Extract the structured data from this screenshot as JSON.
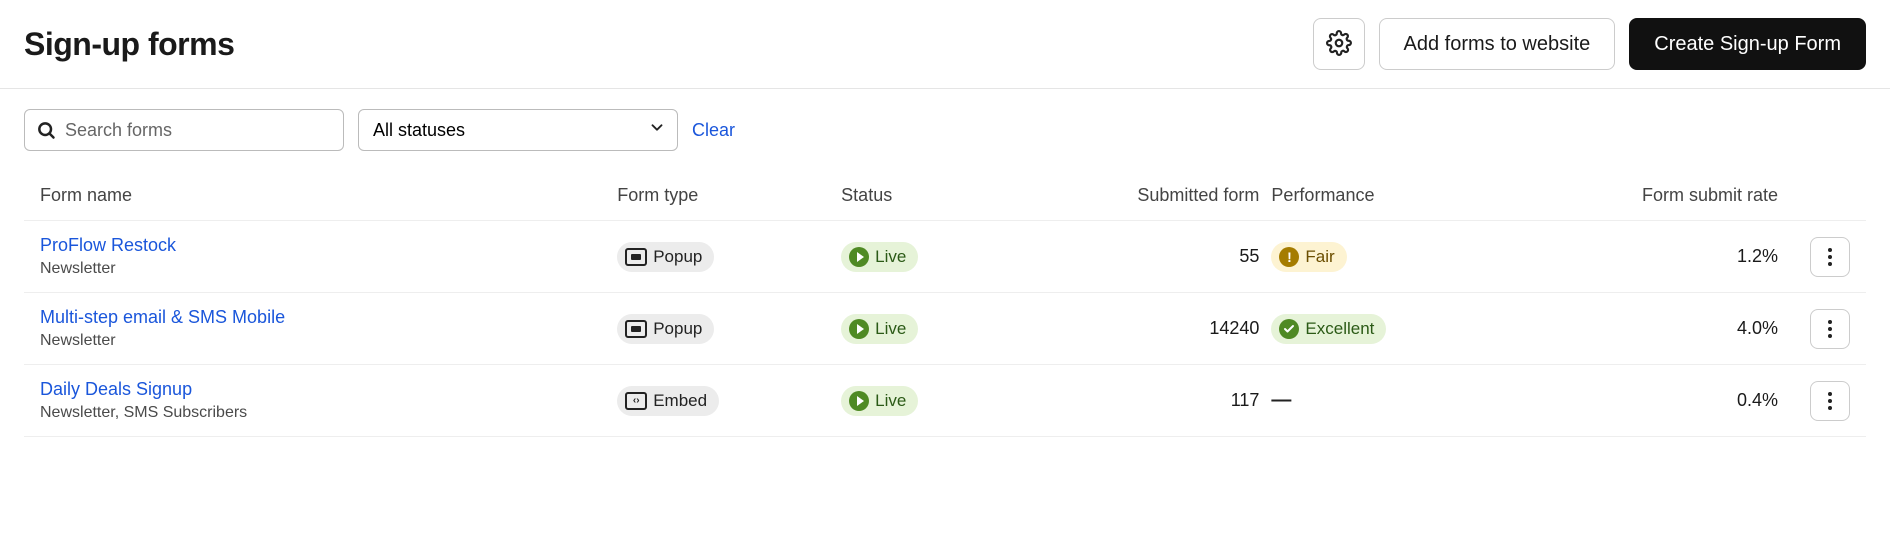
{
  "header": {
    "title": "Sign-up forms",
    "add_label": "Add forms to website",
    "create_label": "Create Sign-up Form"
  },
  "filters": {
    "search_placeholder": "Search forms",
    "status_selected": "All statuses",
    "clear_label": "Clear"
  },
  "columns": {
    "name": "Form name",
    "type": "Form type",
    "status": "Status",
    "submitted": "Submitted form",
    "performance": "Performance",
    "rate": "Form submit rate"
  },
  "rows": [
    {
      "name": "ProFlow Restock",
      "sub": "Newsletter",
      "type": "Popup",
      "type_kind": "popup",
      "status": "Live",
      "submitted": "55",
      "performance": "Fair",
      "perf_kind": "fair",
      "rate": "1.2%"
    },
    {
      "name": "Multi-step email & SMS Mobile",
      "sub": "Newsletter",
      "type": "Popup",
      "type_kind": "popup",
      "status": "Live",
      "submitted": "14240",
      "performance": "Excellent",
      "perf_kind": "excellent",
      "rate": "4.0%"
    },
    {
      "name": "Daily Deals Signup",
      "sub": "Newsletter, SMS Subscribers",
      "type": "Embed",
      "type_kind": "embed",
      "status": "Live",
      "submitted": "117",
      "performance": "—",
      "perf_kind": "none",
      "rate": "0.4%"
    }
  ]
}
